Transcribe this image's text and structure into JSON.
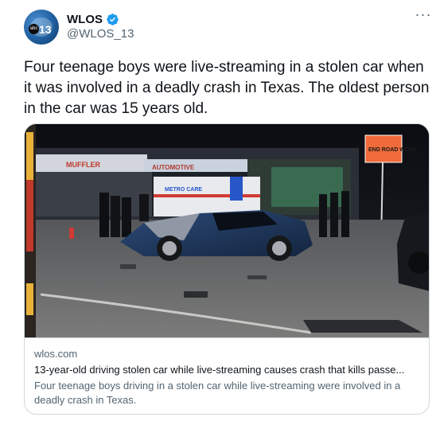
{
  "author": {
    "display_name": "WLOS",
    "handle": "@WLOS_13",
    "avatar_text": "13",
    "avatar_network": "abc",
    "verified": true
  },
  "menu": {
    "icon": "more-horizontal-icon",
    "label": "···"
  },
  "tweet": {
    "text": "Four teenage boys were live-streaming in a stolen car when it was involved in a deadly crash in Texas. The oldest person in the car was 15 years old."
  },
  "photo": {
    "sign_text": "END ROAD WORK",
    "storefront_text": "AUTOMOTIVE",
    "muffler_text": "MUFFLER",
    "ambulance_text": "METRO CARE"
  },
  "link_card": {
    "domain": "wlos.com",
    "title": "13-year-old driving stolen car while live-streaming causes crash that kills passe...",
    "description": "Four teenage boys driving in a stolen car while live-streaming were involved in a deadly crash in Texas."
  },
  "colors": {
    "verified_blue": "#1d9bf0",
    "text_primary": "#0f1419",
    "text_secondary": "#536471",
    "border": "#cfd9de"
  }
}
